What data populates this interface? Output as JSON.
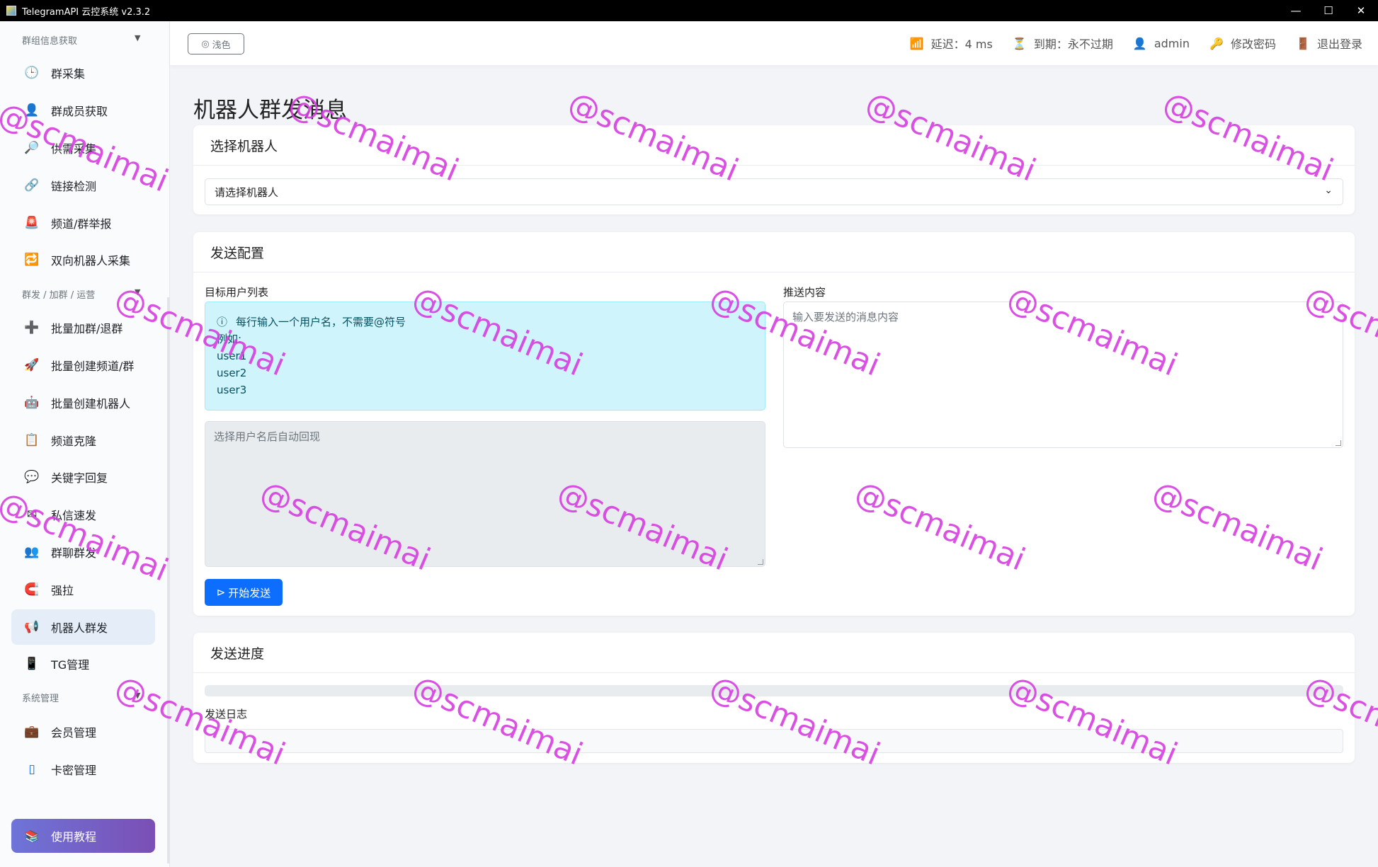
{
  "window": {
    "title": "TelegramAPI 云控系统 v2.3.2",
    "controls": {
      "minimize": "—",
      "maximize": "☐",
      "close": "✕"
    }
  },
  "sidebar": {
    "sections": [
      {
        "label": "群组信息获取",
        "caret": "▼"
      },
      {
        "label": "群发 / 加群 / 运营",
        "caret": "▼"
      },
      {
        "label": "系统管理",
        "caret": "▼"
      }
    ],
    "items": [
      {
        "label": "群采集",
        "icon": "clock-icon",
        "glyph": "🕒"
      },
      {
        "label": "群成员获取",
        "icon": "user-icon",
        "glyph": "👤"
      },
      {
        "label": "供需采集",
        "icon": "magnifier-icon",
        "glyph": "🔎"
      },
      {
        "label": "链接检测",
        "icon": "link-icon",
        "glyph": "🔗"
      },
      {
        "label": "频道/群举报",
        "icon": "siren-icon",
        "glyph": "🚨"
      },
      {
        "label": "双向机器人采集",
        "icon": "repeat-icon",
        "glyph": "🔁"
      },
      {
        "label": "批量加群/退群",
        "icon": "plus-icon",
        "glyph": "➕"
      },
      {
        "label": "批量创建频道/群",
        "icon": "create-icon",
        "glyph": "🚀"
      },
      {
        "label": "批量创建机器人",
        "icon": "robot-icon",
        "glyph": "🤖"
      },
      {
        "label": "频道克隆",
        "icon": "clipboard-icon",
        "glyph": "📋"
      },
      {
        "label": "关键字回复",
        "icon": "chat-icon",
        "glyph": "💬"
      },
      {
        "label": "私信速发",
        "icon": "mail-icon",
        "glyph": "✉"
      },
      {
        "label": "群聊群发",
        "icon": "group-icon",
        "glyph": "👥"
      },
      {
        "label": "强拉",
        "icon": "magnet-icon",
        "glyph": "🧲"
      },
      {
        "label": "机器人群发",
        "icon": "megaphone-icon",
        "glyph": "📢"
      },
      {
        "label": "TG管理",
        "icon": "phone-icon",
        "glyph": "📱"
      },
      {
        "label": "会员管理",
        "icon": "briefcase-icon",
        "glyph": "💼"
      },
      {
        "label": "卡密管理",
        "icon": "card-icon",
        "glyph": "▯"
      }
    ],
    "tutorial": {
      "label": "使用教程",
      "icon": "book-icon",
      "glyph": "📚"
    }
  },
  "header": {
    "theme_button": "浅色",
    "theme_glyph": "◎",
    "latency": "延迟：4 ms",
    "expiry": "到期：永不过期",
    "user": "admin",
    "change_password": "修改密码",
    "logout": "退出登录",
    "glyphs": {
      "latency": "📶",
      "expiry": "⏳",
      "user": "👤",
      "password": "🔑",
      "logout": "🚪"
    }
  },
  "main": {
    "page_title": "机器人群发消息",
    "select_card": {
      "title": "选择机器人",
      "select_value": "请选择机器人"
    },
    "config_card": {
      "title": "发送配置",
      "target_label": "目标用户列表",
      "info_icon": "ⓘ",
      "info_line1": "每行输入一个用户名，不需要@符号",
      "info_line2": "例如:",
      "info_examples": [
        "user1",
        "user2",
        "user3"
      ],
      "auto_fill_placeholder": "选择用户名后自动回现",
      "content_label": "推送内容",
      "content_placeholder": "输入要发送的消息内容",
      "send_button": "开始发送",
      "send_glyph": "⊳"
    },
    "progress_card": {
      "title": "发送进度",
      "progress_value": 0,
      "log_label": "发送日志"
    }
  },
  "watermark": "@scmaimai",
  "colors": {
    "primary": "#0d6efd",
    "info_bg": "#cff4fc",
    "watermark": "#d63ee0"
  }
}
